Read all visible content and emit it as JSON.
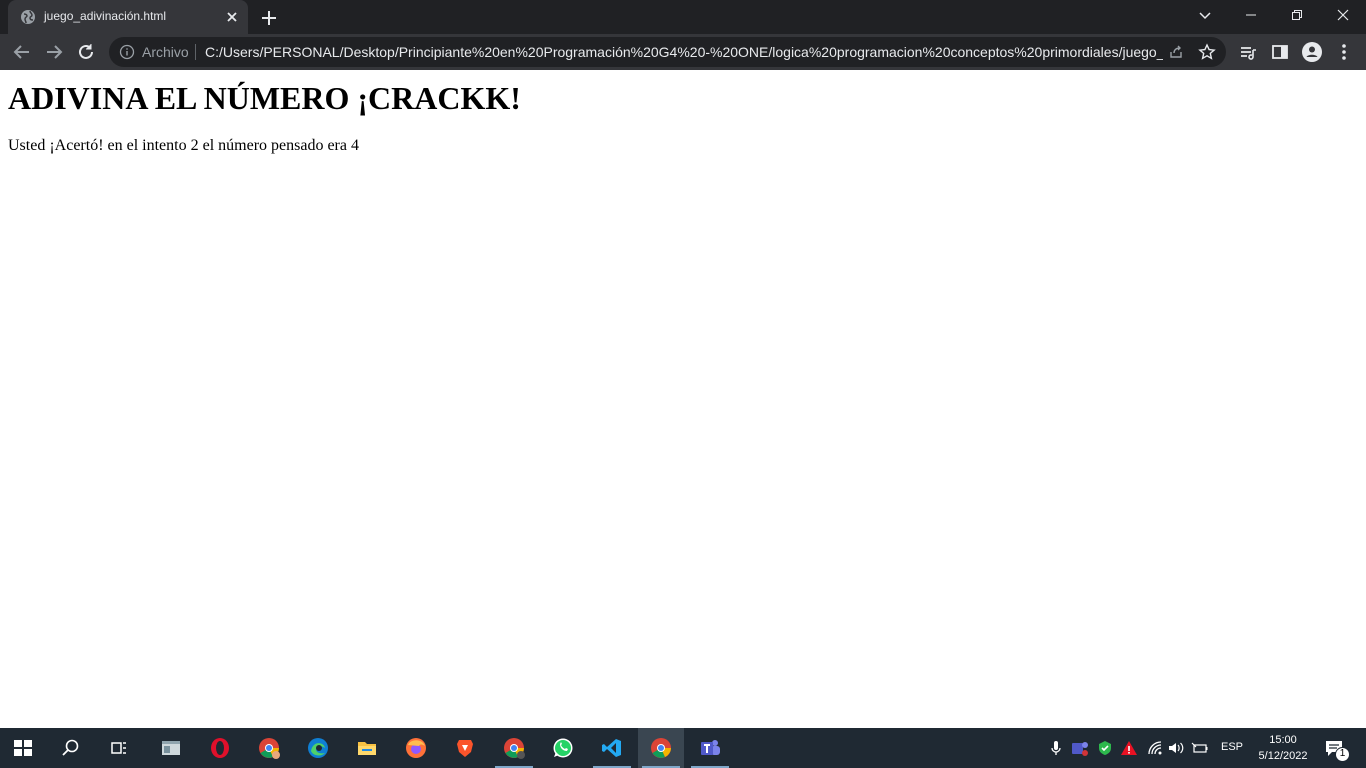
{
  "browser": {
    "tab": {
      "title": "juego_adivinación.html"
    },
    "toolbar": {
      "scheme_label": "Archivo",
      "url": "C:/Users/PERSONAL/Desktop/Principiante%20en%20Programación%20G4%20-%20ONE/logica%20programacion%20conceptos%20primordiales/juego_..."
    }
  },
  "page": {
    "heading": "ADIVINA EL NÚMERO ¡CRACKK!",
    "result": "Usted ¡Acertó! en el intento 2 el número pensado era 4"
  },
  "taskbar": {
    "apps": [
      "start-icon",
      "search-icon",
      "task-view-icon",
      "explorer-window-icon",
      "opera-icon",
      "chrome-profile-icon",
      "edge-icon",
      "file-explorer-icon",
      "firefox-icon",
      "brave-icon",
      "chrome-other-icon",
      "whatsapp-icon",
      "vscode-icon",
      "chrome-icon",
      "teams-icon"
    ],
    "language": "ESP",
    "time": "15:00",
    "date": "5/12/2022",
    "notification_count": "1"
  },
  "colors": {
    "titlebar": "#202124",
    "toolbar": "#35363a",
    "taskbar": "#1f2933",
    "page_bg": "#ffffff"
  }
}
